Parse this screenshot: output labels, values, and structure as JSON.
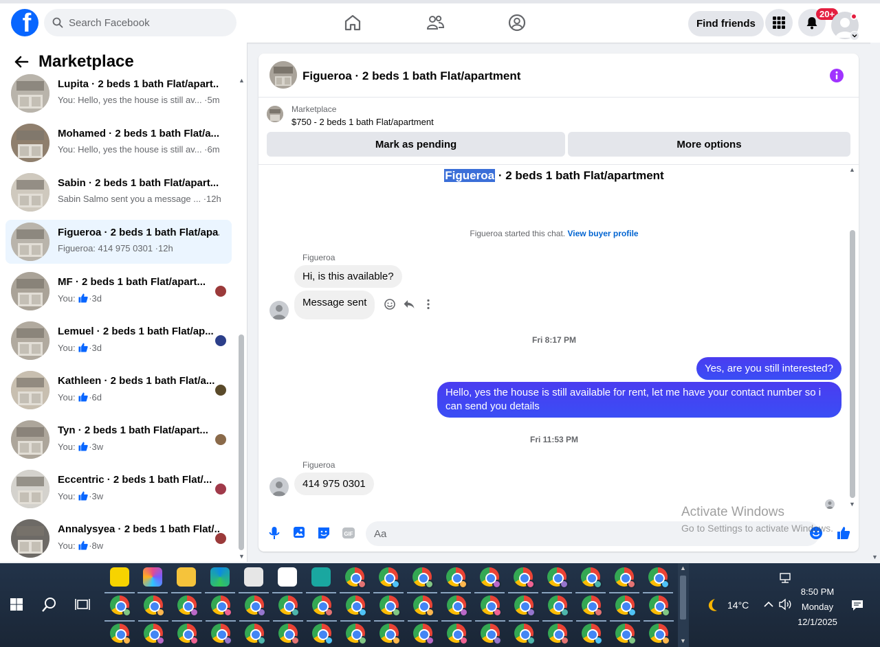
{
  "topbar": {
    "search_placeholder": "Search Facebook",
    "find_friends": "Find friends",
    "notif_badge": "20+"
  },
  "left": {
    "title": "Marketplace",
    "conversations": [
      {
        "name": "Lupita · 2 beds 1 bath Flat/apart...",
        "sub": "You: Hello, yes the house is still av... ·5m",
        "like": false
      },
      {
        "name": "Mohamed · 2 beds 1 bath Flat/a...",
        "sub": "You: Hello, yes the house is still av... ·6m",
        "like": false
      },
      {
        "name": "Sabin · 2 beds 1 bath Flat/apart...",
        "sub": "Sabin Salmo sent you a message ... ·12h",
        "like": false
      },
      {
        "name": "Figueroa · 2 beds 1 bath Flat/apa...",
        "sub": "Figueroa: 414 975 0301 ·12h",
        "like": false,
        "active": true
      },
      {
        "name": "MF · 2 beds 1 bath Flat/apart...",
        "sub_prefix": "You:",
        "sub_suffix": "·3d",
        "like": true
      },
      {
        "name": "Lemuel · 2 beds 1 bath Flat/ap...",
        "sub_prefix": "You:",
        "sub_suffix": "·3d",
        "like": true
      },
      {
        "name": "Kathleen · 2 beds 1 bath Flat/a...",
        "sub_prefix": "You:",
        "sub_suffix": "·6d",
        "like": true
      },
      {
        "name": "Tyn · 2 beds 1 bath Flat/apart...",
        "sub_prefix": "You:",
        "sub_suffix": "·3w",
        "like": true
      },
      {
        "name": "Eccentric · 2 beds 1 bath Flat/...",
        "sub_prefix": "You:",
        "sub_suffix": "·3w",
        "like": true
      },
      {
        "name": "Annalysyea · 2 beds 1 bath Flat/...",
        "sub_prefix": "You:",
        "sub_suffix": "·8w",
        "like": true
      }
    ]
  },
  "chat": {
    "header_title": "Figueroa · 2 beds 1 bath Flat/apartment",
    "listing_label": "Marketplace",
    "listing_price": "$750 - 2 beds 1 bath Flat/apartment",
    "mark_pending": "Mark as pending",
    "more_options": "More options",
    "conv_title_hl": "Figueroa",
    "conv_title_rest": " · 2 beds 1 bath Flat/apartment",
    "started_text": "Figueroa started this chat. ",
    "view_buyer": "View buyer profile",
    "sender1": "Figueroa",
    "msg1": "Hi, is this available?",
    "msg2": "Message sent",
    "time1": "Fri 8:17 PM",
    "out1": "Yes, are you still interested?",
    "out2": "Hello, yes the house is still available for rent, let me have your contact number so i can send you details",
    "time2": "Fri 11:53 PM",
    "sender2": "Figueroa",
    "msg3": "414 975 0301",
    "composer_placeholder": "Aa"
  },
  "watermark": {
    "line1": "Activate Windows",
    "line2": "Go to Settings to activate Windows."
  },
  "taskbar": {
    "temperature": "14°C",
    "time": "8:50 PM",
    "day": "Monday",
    "date": "12/1/2025"
  }
}
